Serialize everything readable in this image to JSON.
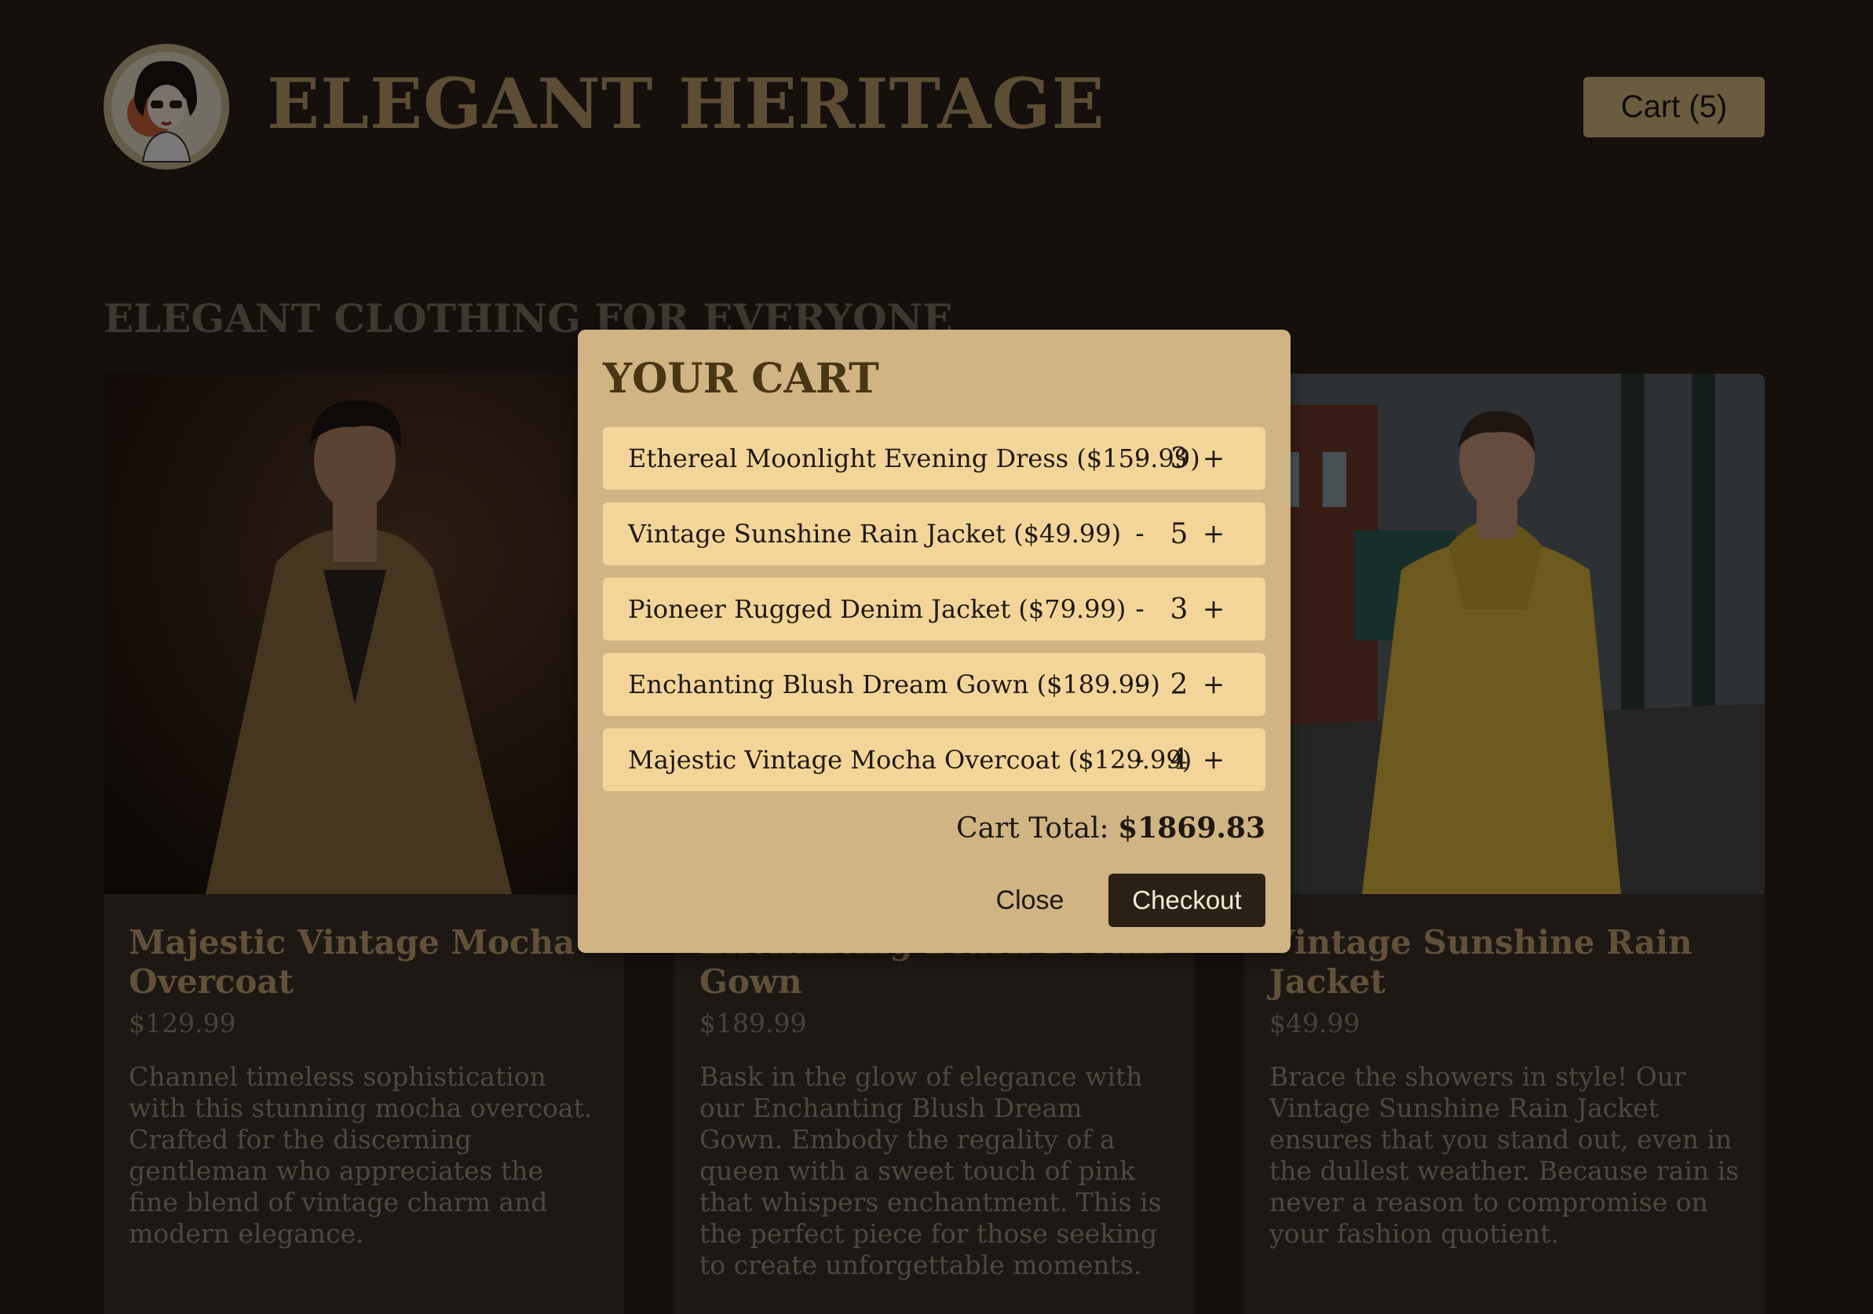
{
  "header": {
    "brand": "ELEGANT HERITAGE",
    "cart_label": "Cart (5)"
  },
  "main": {
    "section_title": "ELEGANT CLOTHING FOR EVERYONE",
    "products": [
      {
        "name": "Majestic Vintage Mocha Overcoat",
        "price": "$129.99",
        "description": "Channel timeless sophistication with this stunning mocha overcoat. Crafted for the discerning gentleman who appreciates the fine blend of vintage charm and modern elegance."
      },
      {
        "name": "Enchanting Blush Dream Gown",
        "price": "$189.99",
        "description": "Bask in the glow of elegance with our Enchanting Blush Dream Gown. Embody the regality of a queen with a sweet touch of pink that whispers enchantment. This is the perfect piece for those seeking to create unforgettable moments."
      },
      {
        "name": "Vintage Sunshine Rain Jacket",
        "price": "$49.99",
        "description": "Brace the showers in style! Our Vintage Sunshine Rain Jacket ensures that you stand out, even in the dullest weather. Because rain is never a reason to compromise on your fashion quotient."
      }
    ]
  },
  "cart": {
    "title": "YOUR CART",
    "items": [
      {
        "label": "Ethereal Moonlight Evening Dress ($159.99)",
        "minus": "-",
        "qty": "3",
        "plus": "+"
      },
      {
        "label": "Vintage Sunshine Rain Jacket ($49.99)",
        "minus": "-",
        "qty": "5",
        "plus": "+"
      },
      {
        "label": "Pioneer Rugged Denim Jacket ($79.99)",
        "minus": "-",
        "qty": "3",
        "plus": "+"
      },
      {
        "label": "Enchanting Blush Dream Gown ($189.99)",
        "minus": "-",
        "qty": "2",
        "plus": "+"
      },
      {
        "label": "Majestic Vintage Mocha Overcoat ($129.99)",
        "minus": "-",
        "qty": "4",
        "plus": "+"
      }
    ],
    "total_label": "Cart Total:",
    "total_value": "$1869.83",
    "close_label": "Close",
    "checkout_label": "Checkout"
  },
  "colors": {
    "background": "#120e09",
    "accent": "#d9b97e",
    "modal": "#d0b483",
    "cart_item": "#f4d599",
    "checkout": "#2a2114"
  }
}
